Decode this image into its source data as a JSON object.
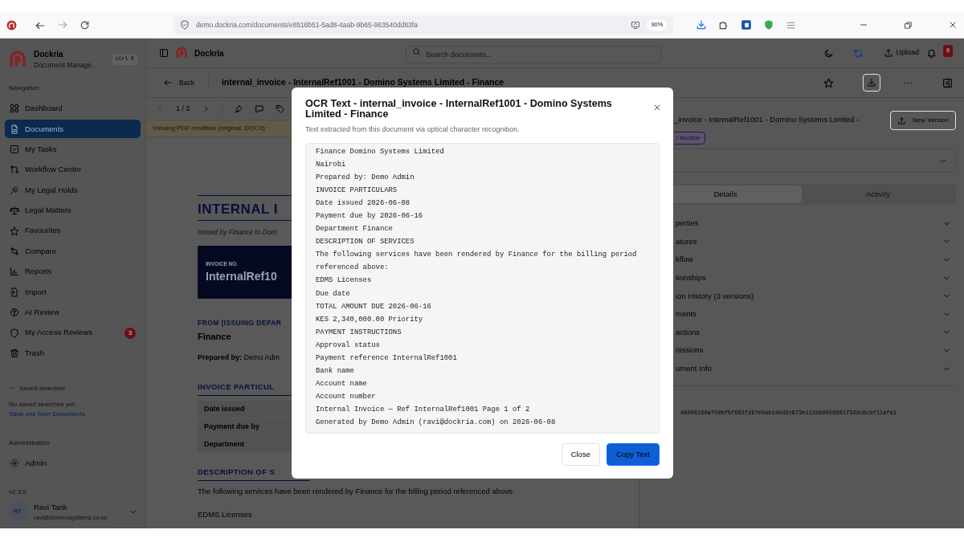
{
  "browser": {
    "url": "demo.dockria.com/documents/e8516b51-5ad8-4aab-9b65-963540dd83fa",
    "zoom": "90%"
  },
  "sidebar": {
    "brand": "Dockria",
    "subtitle": "Document Manage...",
    "shortcut": "ctrl K",
    "nav_title": "Navigation",
    "items": [
      {
        "label": "Dashboard",
        "selected": false
      },
      {
        "label": "Documents",
        "selected": true
      },
      {
        "label": "My Tasks",
        "selected": false
      },
      {
        "label": "Workflow Center",
        "selected": false
      },
      {
        "label": "My Legal Holds",
        "selected": false
      },
      {
        "label": "Legal Matters",
        "selected": false
      },
      {
        "label": "Favourites",
        "selected": false
      },
      {
        "label": "Compare",
        "selected": false
      },
      {
        "label": "Reports",
        "selected": false
      },
      {
        "label": "Import",
        "selected": false
      },
      {
        "label": "AI Review",
        "selected": false
      },
      {
        "label": "My Access Reviews",
        "selected": false,
        "badge": "3"
      },
      {
        "label": "Trash",
        "selected": false
      }
    ],
    "saved_searches": {
      "title": "Saved searches",
      "empty_text": "No saved searches yet.",
      "link": "Save one from Documents"
    },
    "admin_title": "Administration",
    "admin_items": [
      {
        "label": "Admin",
        "selected": false
      }
    ],
    "version": "v2.3.0",
    "user": {
      "initials": "RT",
      "name": "Ravi Tank",
      "email": "ravi@dominosystems.co.ke"
    }
  },
  "header": {
    "brand": "Dockria",
    "search_placeholder": "Search documents...",
    "upload": "Upload",
    "notifications": "9"
  },
  "document": {
    "back": "Back",
    "title": "internal_invoice - InternalRef1001 - Domino Systems Limited - Finance",
    "page": "1 / 2",
    "notice": "Viewing PDF rendition (original: DOCX)",
    "content": {
      "heading": "INTERNAL I",
      "subheading": "Issued by Finance to Dom",
      "invoice_label": "INVOICE NO.",
      "invoice_no": "InternalRef10",
      "from_label": "FROM (ISSUING DEPAR",
      "from_value": "Finance",
      "prepared": "**Prepared by:** Demo Adm",
      "section_1": "INVOICE PARTICUL",
      "rows": [
        "Date issued",
        "Payment due by",
        "Department"
      ],
      "section_2": "DESCRIPTION OF S",
      "paragraph": "The following services have been rendered by Finance for the billing period referenced above.",
      "item": "EDMS Licenses"
    }
  },
  "details_panel": {
    "title": "_invoice - InternalRef1001 - Domino Systems Limited -",
    "new_version": "New Version",
    "tag": "l Invoice",
    "tabs": [
      {
        "label": "Details",
        "selected": true
      },
      {
        "label": "Activity",
        "selected": false
      }
    ],
    "sections": [
      "perties",
      "atures",
      "kflow",
      "tionships",
      "ion History (3 versions)",
      "ments",
      "actions",
      "nissions",
      "ument Info"
    ],
    "hash": "4b008160a750bf5f602f267e0ab140d2c673e111b99028881732dc6cbf11afa1"
  },
  "modal": {
    "title": "OCR Text - internal_invoice - InternalRef1001 - Domino Systems Limited - Finance",
    "subtitle": "Text extracted from this document via optical character recognition.",
    "lines": [
      "Finance Domino Systems Limited",
      "Nairobi",
      "Prepared by: Demo Admin",
      "INVOICE PARTICULARS",
      "Date issued 2026-06-08",
      "Payment due by 2026-06-16",
      "Department Finance",
      "DESCRIPTION OF SERVICES",
      "The following services have been rendered by Finance for the billing period referenced above:",
      "EDMS Licenses",
      "Due date",
      "TOTAL AMOUNT DUE 2026-06-16",
      "KES 2,340,000.00 Priority",
      "PAYMENT INSTRUCTIONS",
      "Approval status",
      "Payment reference InternalRef1001",
      "Bank name",
      "Account name",
      "Account number",
      "Internal Invoice — Ref InternalRef1001 Page 1 of 2",
      "Generated by Demo Admin (ravi@dockria.com) on 2026-06-08"
    ],
    "buttons": [
      {
        "label": "Close",
        "kind": "secondary"
      },
      {
        "label": "Copy Text",
        "kind": "primary"
      }
    ]
  }
}
